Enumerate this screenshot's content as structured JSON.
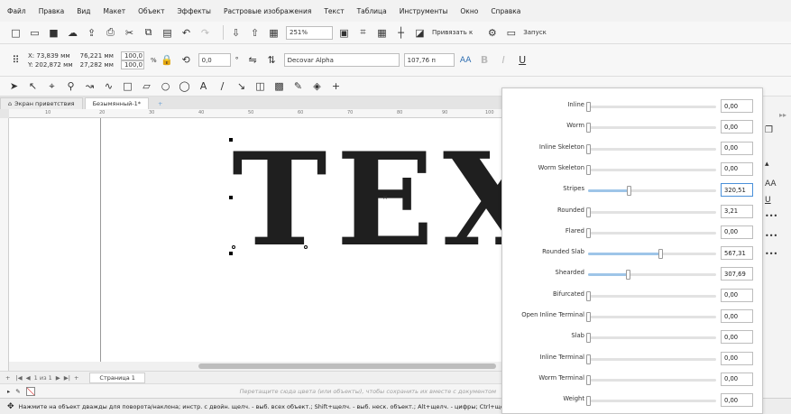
{
  "menu": [
    "Файл",
    "Правка",
    "Вид",
    "Макет",
    "Объект",
    "Эффекты",
    "Растровые изображения",
    "Текст",
    "Таблица",
    "Инструменты",
    "Окно",
    "Справка"
  ],
  "toolbar1": {
    "zoom": "251%",
    "snap_label": "Привязать к",
    "launch_label": "Запуск"
  },
  "toolbar2": {
    "x": "X: 73,839 мм",
    "y": "Y: 202,872 мм",
    "width": "76,221 мм",
    "height": "27,282 мм",
    "scale_x": "100,0",
    "scale_y": "100,0",
    "percent": "%",
    "rotation": "0,0",
    "degree": "°",
    "font": "Decovar Alpha",
    "font_size": "107,76 п"
  },
  "tabs": {
    "welcome": "Экран приветствия",
    "document": "Безымянный-1*",
    "add": "+"
  },
  "ruler_marks": [
    "10",
    "20",
    "30",
    "40",
    "50",
    "60",
    "70",
    "80",
    "90",
    "100"
  ],
  "canvas": {
    "text": "TEXT"
  },
  "pagebar": {
    "nav": "1 из 1",
    "page_tab": "Страница 1"
  },
  "colorbar": {
    "hint": "Перетащите сюда цвета (или объекты), чтобы сохранить их вместе с документом"
  },
  "status": "Нажмите на объект дважды для поворота/наклона; инстр. с двойн. щелч. - выб. всех объект.; Shift+щелч. - выб. неск. объект.; Alt+щелч. - цифры; Ctrl+щелч. - выбор в группе",
  "axes": [
    {
      "label": "Inline",
      "value": "0,00",
      "level": 0
    },
    {
      "label": "Worm",
      "value": "0,00",
      "level": 0
    },
    {
      "label": "Inline Skeleton",
      "value": "0,00",
      "level": 0
    },
    {
      "label": "Worm Skeleton",
      "value": "0,00",
      "level": 0
    },
    {
      "label": "Stripes",
      "value": "320,51",
      "level": 0.32
    },
    {
      "label": "Rounded",
      "value": "3,21",
      "level": 0
    },
    {
      "label": "Flared",
      "value": "0,00",
      "level": 0
    },
    {
      "label": "Rounded Slab",
      "value": "567,31",
      "level": 0.57
    },
    {
      "label": "Shearded",
      "value": "307,69",
      "level": 0.31
    },
    {
      "label": "Bifurcated",
      "value": "0,00",
      "level": 0
    },
    {
      "label": "Open Inline Terminal",
      "value": "0,00",
      "level": 0
    },
    {
      "label": "Slab",
      "value": "0,00",
      "level": 0
    },
    {
      "label": "Inline Terminal",
      "value": "0,00",
      "level": 0
    },
    {
      "label": "Worm Terminal",
      "value": "0,00",
      "level": 0
    },
    {
      "label": "Weight",
      "value": "0,00",
      "level": 0
    }
  ],
  "colors": {
    "accent": "#4a90d9",
    "slider_fill": "#9ec5e8"
  }
}
